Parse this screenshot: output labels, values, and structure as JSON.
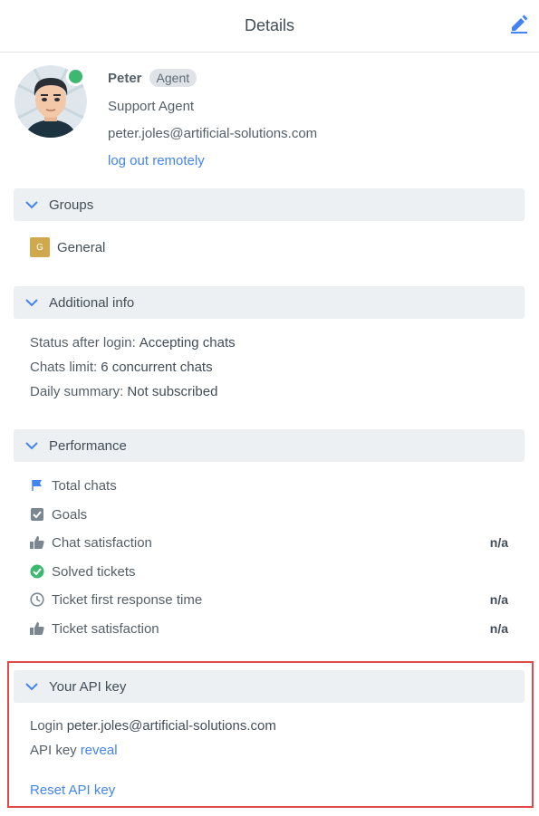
{
  "header": {
    "title": "Details",
    "edit_icon": "pencil-icon"
  },
  "profile": {
    "name": "Peter",
    "badge": "Agent",
    "role": "Support Agent",
    "email": "peter.joles@artificial-solutions.com",
    "logout_label": "log out remotely",
    "status_color": "#3cb96e"
  },
  "sections": {
    "groups": {
      "title": "Groups",
      "items": [
        {
          "initial": "G",
          "label": "General"
        }
      ]
    },
    "additional_info": {
      "title": "Additional info",
      "rows": [
        {
          "label": "Status after login:",
          "value": "Accepting chats"
        },
        {
          "label": "Chats limit:",
          "value": "6 concurrent chats"
        },
        {
          "label": "Daily summary:",
          "value": "Not subscribed"
        }
      ]
    },
    "performance": {
      "title": "Performance",
      "rows": [
        {
          "label": "Total chats",
          "value": "",
          "icon": "flag-icon"
        },
        {
          "label": "Goals",
          "value": "",
          "icon": "checkbox-icon"
        },
        {
          "label": "Chat satisfaction",
          "value": "n/a",
          "icon": "thumbs-up-icon"
        },
        {
          "label": "Solved tickets",
          "value": "",
          "icon": "check-circle-icon"
        },
        {
          "label": "Ticket first response time",
          "value": "n/a",
          "icon": "clock-icon"
        },
        {
          "label": "Ticket satisfaction",
          "value": "n/a",
          "icon": "thumbs-up-icon"
        }
      ]
    },
    "api_key": {
      "title": "Your API key",
      "login_label": "Login",
      "login_value": "peter.joles@artificial-solutions.com",
      "key_label": "API key",
      "reveal_label": "reveal",
      "reset_label": "Reset API key"
    }
  },
  "colors": {
    "accent": "#4384f5",
    "highlight": "#de4a46",
    "group": "#d0a94c"
  }
}
